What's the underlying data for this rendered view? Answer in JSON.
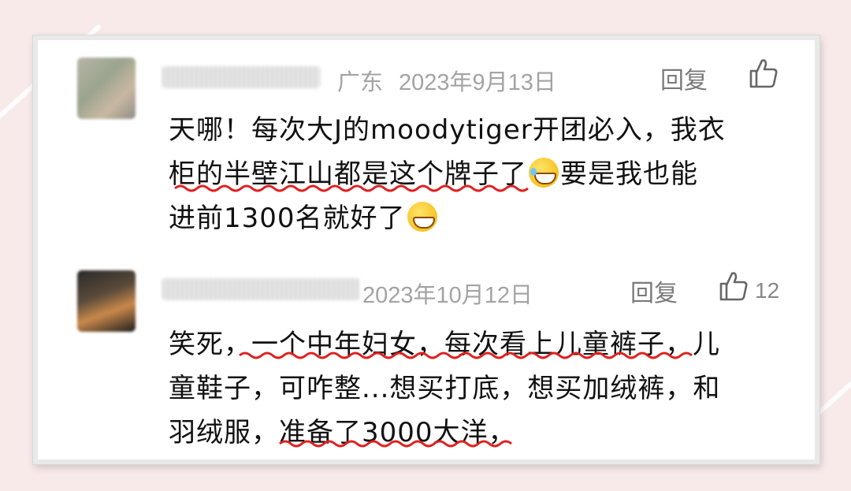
{
  "comments": [
    {
      "location": "广东",
      "date": "2023年9月13日",
      "reply_label": "回复",
      "like_count": "",
      "lines": [
        "天哪！每次大J的moodytiger开团必入，我衣",
        "柜的半壁江山都是这个牌子了",
        "要是我也能",
        "进前1300名就好了"
      ],
      "emojis": [
        "laughing-tears-icon",
        "grinning-icon"
      ]
    },
    {
      "location": "",
      "date": "2023年10月12日",
      "reply_label": "回复",
      "like_count": "12",
      "lines": [
        "笑死，一个中年妇女，每次看上儿童裤子，儿",
        "童鞋子，可咋整...想买打底，想买加绒裤，和",
        "羽绒服，准备了3000大洋，"
      ]
    }
  ],
  "colors": {
    "underline": "#e02020",
    "meta_text": "#a3a3a3",
    "body_text": "#111111",
    "background": "#f9eaea"
  }
}
